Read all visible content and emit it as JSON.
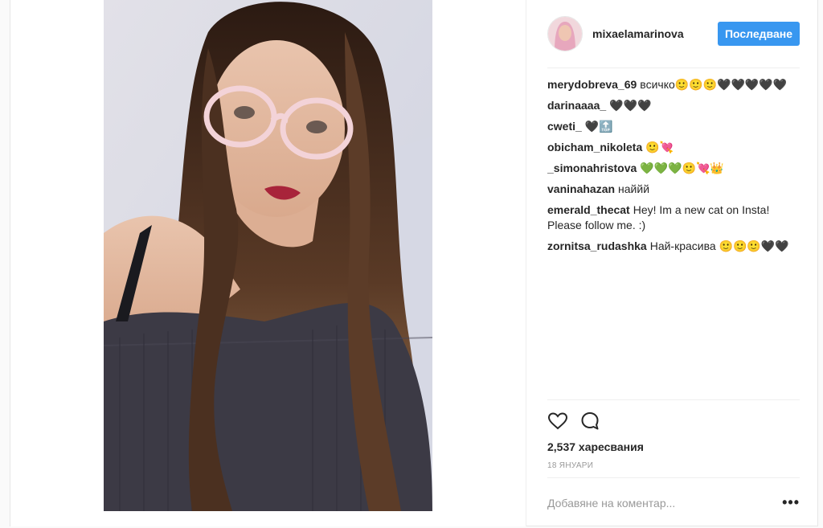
{
  "post": {
    "username": "mixaelamarinova",
    "follow_label": "Последване",
    "likes_text": "2,537 харесвания",
    "date_text": "18 ЯНУАРИ",
    "comment_placeholder": "Добавяне на коментар...",
    "more_label": "•••"
  },
  "comments": [
    {
      "user": "merydobreva_69",
      "text": "всичко🙂🙂🙂🖤🖤🖤🖤🖤"
    },
    {
      "user": "darinaaaa_",
      "text": "🖤🖤🖤"
    },
    {
      "user": "cweti_",
      "text": "🖤🔝"
    },
    {
      "user": "obicham_nikoleta",
      "text": "🙂💘"
    },
    {
      "user": "_simonahristova",
      "text": "💚💚💚🙂💘👑"
    },
    {
      "user": "vaninahazan",
      "text": "наййй"
    },
    {
      "user": "emerald_thecat",
      "text": "Hey! Im a new cat on Insta! Please follow me. :)"
    },
    {
      "user": "zornitsa_rudashka",
      "text": "Най-красива 🙂🙂🙂🖤🖤"
    }
  ],
  "icons": {
    "like": "heart-icon",
    "comment": "comment-bubble-icon"
  },
  "colors": {
    "accent": "#3897f0",
    "text": "#262626",
    "muted": "#999999",
    "border": "#efefef"
  }
}
